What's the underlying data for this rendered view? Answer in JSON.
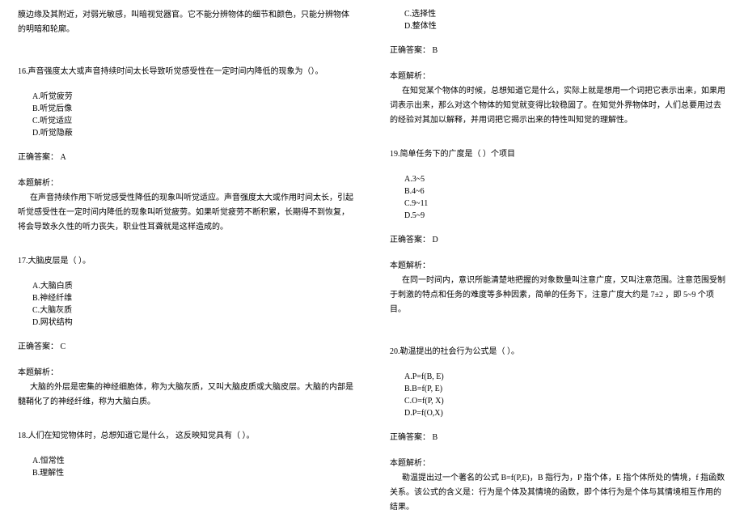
{
  "left": {
    "topFragment": "膜边缘及其附近，对弱光敏感，叫暗视觉器官。它不能分辨物体的细节和颜色，只能分辨物体的明暗和轮廓。",
    "q16": {
      "title": "16.声音强度太大或声音持续时间太长导致听觉感受性在一定时间内降低的现象为（）。",
      "opts": {
        "a": "A.听觉疲劳",
        "b": "B.听觉后像",
        "c": "C.听觉适应",
        "d": "D.听觉隐蔽"
      },
      "answer": "正确答案：   A",
      "analysisLabel": "本题解析：",
      "analysisText": "在声音持续作用下听觉感受性降低的现象叫听觉适应。声音强度太大或作用时间太长，引起听觉感受性在一定时间内降低的现象叫听觉疲劳。如果听觉疲劳不断积累，长期得不到恢复，将会导致永久性的听力丧失，职业性耳聋就是这样造成的。"
    },
    "q17": {
      "title": "17.大脑皮层是（  ）。",
      "opts": {
        "a": "A.大脑白质",
        "b": "B.神经纤维",
        "c": "C.大脑灰质",
        "d": "D.网状结构"
      },
      "answer": "正确答案：   C",
      "analysisLabel": "本题解析：",
      "analysisText": "大脑的外层是密集的神经细胞体，称为大脑灰质，又叫大脑皮质或大脑皮层。大脑的内部是髓鞘化了的神经纤维，称为大脑白质。"
    },
    "q18": {
      "title": "18.人们在知觉物体时，总想知道它是什么，   这反映知觉具有（  ）。",
      "opts": {
        "a": "A.恒常性",
        "b": "B.理解性"
      }
    }
  },
  "right": {
    "q18cont": {
      "opts": {
        "c": "C.选择性",
        "d": "D.整体性"
      },
      "answer": "正确答案：   B",
      "analysisLabel": "本题解析：",
      "analysisText": "在知觉某个物体的时候，总想知道它是什么，实际上就是想用一个词把它表示出来，如果用词表示出来，那么对这个物体的知觉就变得比较稳固了。在知觉外界物体时，人们总要用过去的经验对其加以解释，并用词把它揭示出来的特性叫知觉的理解性。"
    },
    "q19": {
      "title": "19.简单任务下的广度是（  ）个项目",
      "opts": {
        "a": "A.3~5",
        "b": "B.4~6",
        "c": "C.9~11",
        "d": "D.5~9"
      },
      "answer": "正确答案：   D",
      "analysisLabel": "本题解析：",
      "analysisText": "在同一时间内，意识所能清楚地把握的对象数量叫注意广度，又叫注意范围。注意范围受制于刺激的特点和任务的难度等多种因素，简单的任务下，注意广度大约是 7±2 ，即 5~9 个项目。"
    },
    "q20": {
      "title": "20.勒温提出的社会行为公式是（  ）。",
      "opts": {
        "a": "A.P=f(B, E)",
        "b": "B.B=f(P, E)",
        "c": "C.O=f(P, X)",
        "d": "D.P=f(O,X)"
      },
      "answer": "正确答案：   B",
      "analysisLabel": "本题解析：",
      "analysisText": "勒温提出过一个著名的公式 B=f(P,E)，B 指行为，P 指个体，E 指个体所处的情境，f 指函数关系。该公式的含义是：行为是个体及其情境的函数，即个体行为是个体与其情境相互作用的结果。"
    }
  }
}
